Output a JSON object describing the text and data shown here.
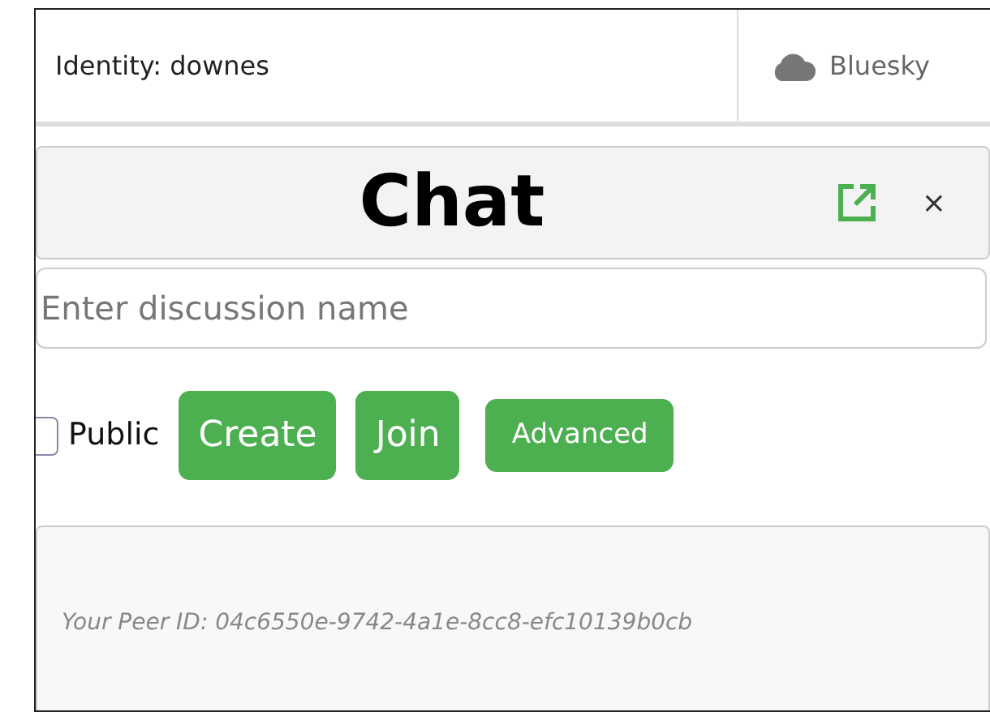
{
  "header": {
    "identity": "Identity: downes",
    "service": "Bluesky"
  },
  "chat": {
    "title": "Chat",
    "close": "×"
  },
  "discussion": {
    "placeholder": "Enter discussion name"
  },
  "public": {
    "label": "Public",
    "checked": false
  },
  "buttons": [
    {
      "label": "Create",
      "kind": "large"
    },
    {
      "label": "Join",
      "kind": "large"
    },
    {
      "label": "Advanced",
      "kind": "small"
    }
  ],
  "peer_id": "Your Peer ID: 04c6550e-9742-4a1e-8cc8-efc10139b0cb"
}
